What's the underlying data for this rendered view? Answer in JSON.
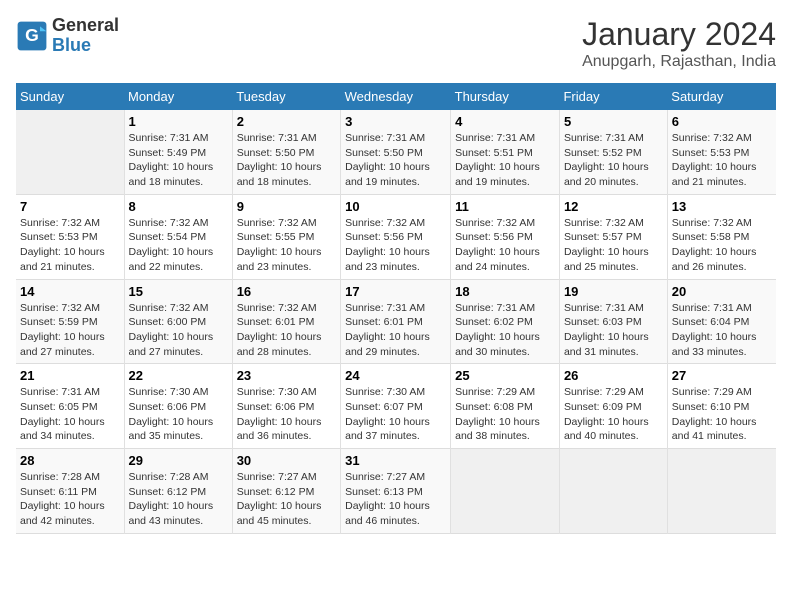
{
  "logo": {
    "line1": "General",
    "line2": "Blue"
  },
  "title": "January 2024",
  "subtitle": "Anupgarh, Rajasthan, India",
  "days_of_week": [
    "Sunday",
    "Monday",
    "Tuesday",
    "Wednesday",
    "Thursday",
    "Friday",
    "Saturday"
  ],
  "weeks": [
    [
      {
        "num": "",
        "detail": ""
      },
      {
        "num": "1",
        "detail": "Sunrise: 7:31 AM\nSunset: 5:49 PM\nDaylight: 10 hours\nand 18 minutes."
      },
      {
        "num": "2",
        "detail": "Sunrise: 7:31 AM\nSunset: 5:50 PM\nDaylight: 10 hours\nand 18 minutes."
      },
      {
        "num": "3",
        "detail": "Sunrise: 7:31 AM\nSunset: 5:50 PM\nDaylight: 10 hours\nand 19 minutes."
      },
      {
        "num": "4",
        "detail": "Sunrise: 7:31 AM\nSunset: 5:51 PM\nDaylight: 10 hours\nand 19 minutes."
      },
      {
        "num": "5",
        "detail": "Sunrise: 7:31 AM\nSunset: 5:52 PM\nDaylight: 10 hours\nand 20 minutes."
      },
      {
        "num": "6",
        "detail": "Sunrise: 7:32 AM\nSunset: 5:53 PM\nDaylight: 10 hours\nand 21 minutes."
      }
    ],
    [
      {
        "num": "7",
        "detail": "Sunrise: 7:32 AM\nSunset: 5:53 PM\nDaylight: 10 hours\nand 21 minutes."
      },
      {
        "num": "8",
        "detail": "Sunrise: 7:32 AM\nSunset: 5:54 PM\nDaylight: 10 hours\nand 22 minutes."
      },
      {
        "num": "9",
        "detail": "Sunrise: 7:32 AM\nSunset: 5:55 PM\nDaylight: 10 hours\nand 23 minutes."
      },
      {
        "num": "10",
        "detail": "Sunrise: 7:32 AM\nSunset: 5:56 PM\nDaylight: 10 hours\nand 23 minutes."
      },
      {
        "num": "11",
        "detail": "Sunrise: 7:32 AM\nSunset: 5:56 PM\nDaylight: 10 hours\nand 24 minutes."
      },
      {
        "num": "12",
        "detail": "Sunrise: 7:32 AM\nSunset: 5:57 PM\nDaylight: 10 hours\nand 25 minutes."
      },
      {
        "num": "13",
        "detail": "Sunrise: 7:32 AM\nSunset: 5:58 PM\nDaylight: 10 hours\nand 26 minutes."
      }
    ],
    [
      {
        "num": "14",
        "detail": "Sunrise: 7:32 AM\nSunset: 5:59 PM\nDaylight: 10 hours\nand 27 minutes."
      },
      {
        "num": "15",
        "detail": "Sunrise: 7:32 AM\nSunset: 6:00 PM\nDaylight: 10 hours\nand 27 minutes."
      },
      {
        "num": "16",
        "detail": "Sunrise: 7:32 AM\nSunset: 6:01 PM\nDaylight: 10 hours\nand 28 minutes."
      },
      {
        "num": "17",
        "detail": "Sunrise: 7:31 AM\nSunset: 6:01 PM\nDaylight: 10 hours\nand 29 minutes."
      },
      {
        "num": "18",
        "detail": "Sunrise: 7:31 AM\nSunset: 6:02 PM\nDaylight: 10 hours\nand 30 minutes."
      },
      {
        "num": "19",
        "detail": "Sunrise: 7:31 AM\nSunset: 6:03 PM\nDaylight: 10 hours\nand 31 minutes."
      },
      {
        "num": "20",
        "detail": "Sunrise: 7:31 AM\nSunset: 6:04 PM\nDaylight: 10 hours\nand 33 minutes."
      }
    ],
    [
      {
        "num": "21",
        "detail": "Sunrise: 7:31 AM\nSunset: 6:05 PM\nDaylight: 10 hours\nand 34 minutes."
      },
      {
        "num": "22",
        "detail": "Sunrise: 7:30 AM\nSunset: 6:06 PM\nDaylight: 10 hours\nand 35 minutes."
      },
      {
        "num": "23",
        "detail": "Sunrise: 7:30 AM\nSunset: 6:06 PM\nDaylight: 10 hours\nand 36 minutes."
      },
      {
        "num": "24",
        "detail": "Sunrise: 7:30 AM\nSunset: 6:07 PM\nDaylight: 10 hours\nand 37 minutes."
      },
      {
        "num": "25",
        "detail": "Sunrise: 7:29 AM\nSunset: 6:08 PM\nDaylight: 10 hours\nand 38 minutes."
      },
      {
        "num": "26",
        "detail": "Sunrise: 7:29 AM\nSunset: 6:09 PM\nDaylight: 10 hours\nand 40 minutes."
      },
      {
        "num": "27",
        "detail": "Sunrise: 7:29 AM\nSunset: 6:10 PM\nDaylight: 10 hours\nand 41 minutes."
      }
    ],
    [
      {
        "num": "28",
        "detail": "Sunrise: 7:28 AM\nSunset: 6:11 PM\nDaylight: 10 hours\nand 42 minutes."
      },
      {
        "num": "29",
        "detail": "Sunrise: 7:28 AM\nSunset: 6:12 PM\nDaylight: 10 hours\nand 43 minutes."
      },
      {
        "num": "30",
        "detail": "Sunrise: 7:27 AM\nSunset: 6:12 PM\nDaylight: 10 hours\nand 45 minutes."
      },
      {
        "num": "31",
        "detail": "Sunrise: 7:27 AM\nSunset: 6:13 PM\nDaylight: 10 hours\nand 46 minutes."
      },
      {
        "num": "",
        "detail": ""
      },
      {
        "num": "",
        "detail": ""
      },
      {
        "num": "",
        "detail": ""
      }
    ]
  ]
}
